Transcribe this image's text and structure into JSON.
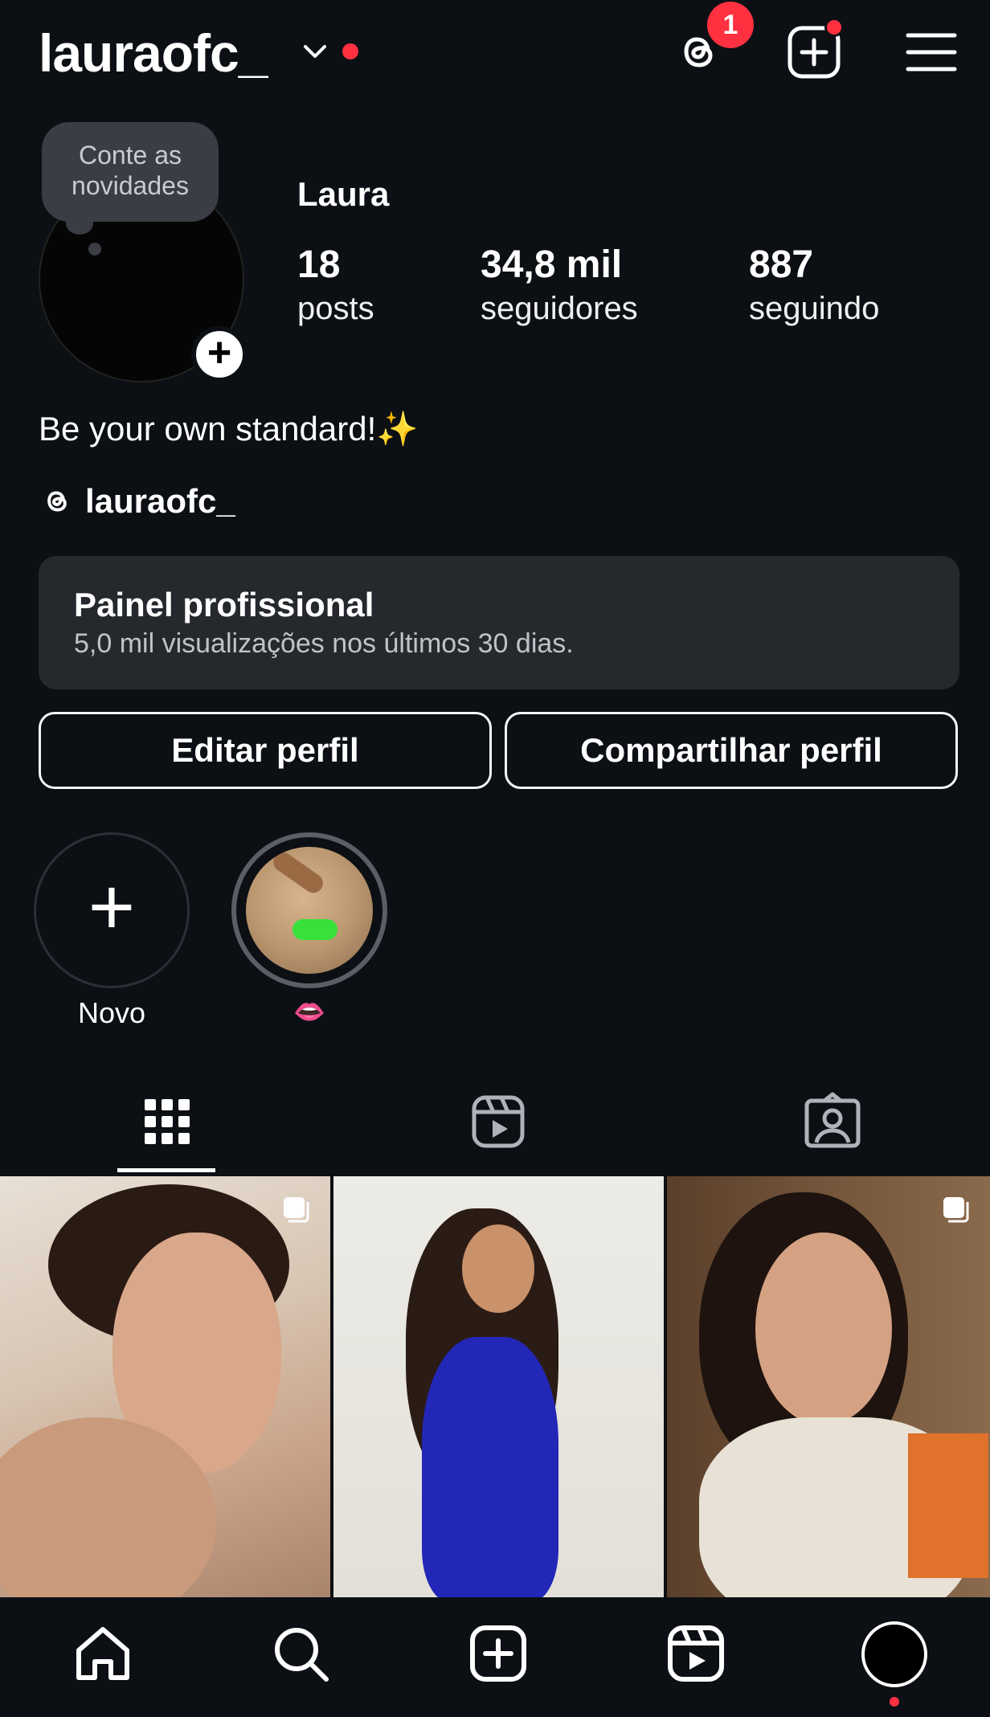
{
  "header": {
    "username": "lauraofc_",
    "threads_badge": "1"
  },
  "profile": {
    "note_bubble": "Conte as novidades",
    "display_name": "Laura",
    "stats": {
      "posts_count": "18",
      "posts_label": "posts",
      "followers_count": "34,8 mil",
      "followers_label": "seguidores",
      "following_count": "887",
      "following_label": "seguindo"
    },
    "bio": "Be your own standard!",
    "bio_emoji": "✨",
    "threads_handle": "lauraofc_"
  },
  "dashboard": {
    "title": "Painel profissional",
    "subtitle": "5,0 mil visualizações nos últimos 30 dias."
  },
  "buttons": {
    "edit": "Editar perfil",
    "share": "Compartilhar perfil"
  },
  "highlights": [
    {
      "label": "Novo"
    },
    {
      "label": "👄"
    }
  ],
  "tabs": [
    "grid-icon",
    "reels-icon",
    "tagged-icon"
  ],
  "colors": {
    "background": "#0c1014",
    "accent_red": "#ff3040",
    "panel": "#25292e"
  }
}
